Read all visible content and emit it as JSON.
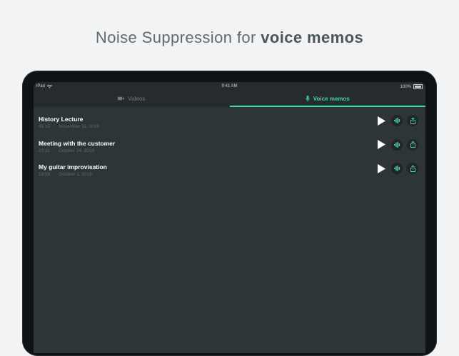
{
  "headline": {
    "prefix": "Noise Suppression for",
    "emphasis": "voice memos"
  },
  "statusbar": {
    "device": "iPad",
    "time": "9:41 AM",
    "battery": "100%"
  },
  "tabs": [
    {
      "label": "Videos",
      "icon": "video-camera-icon",
      "active": false
    },
    {
      "label": "Voice memos",
      "icon": "microphone-icon",
      "active": true
    }
  ],
  "memos": [
    {
      "title": "History Lecture",
      "duration": "45:15",
      "date": "November 11, 2018"
    },
    {
      "title": "Meeting with the customer",
      "duration": "23:11",
      "date": "October 24, 2018"
    },
    {
      "title": "My guitar improvisation",
      "duration": "18:58",
      "date": "October 1, 2018"
    }
  ],
  "colors": {
    "accent": "#3ed6a0",
    "screen_bg": "#2e3539",
    "page_bg": "#f1f3f4"
  }
}
